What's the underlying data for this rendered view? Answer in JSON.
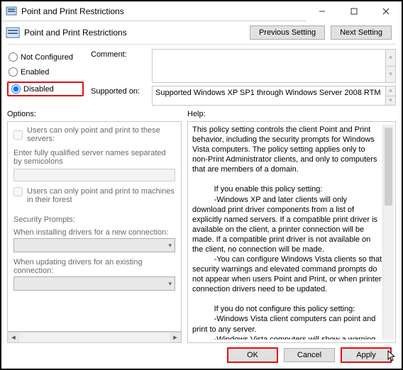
{
  "window": {
    "title": "Point and Print Restrictions"
  },
  "header": {
    "title": "Point and Print Restrictions",
    "prev": "Previous Setting",
    "next": "Next Setting"
  },
  "radios": {
    "not_configured": "Not Configured",
    "enabled": "Enabled",
    "disabled": "Disabled"
  },
  "meta": {
    "comment_label": "Comment:",
    "comment_value": "",
    "supported_label": "Supported on:",
    "supported_value": "Supported Windows XP SP1 through Windows Server 2008 RTM"
  },
  "options": {
    "header": "Options:",
    "chk1": "Users can only point and print to these servers:",
    "text1": "Enter fully qualified server names separated by semicolons",
    "chk2": "Users can only point and print to machines in their forest",
    "sec_prompts": "Security Prompts:",
    "install_label": "When installing drivers for a new connection:",
    "update_label": "When updating drivers for an existing connection:"
  },
  "help": {
    "header": "Help:",
    "text": "This policy setting controls the client Point and Print behavior, including the security prompts for Windows Vista computers. The policy setting applies only to non-Print Administrator clients, and only to computers that are members of a domain.\n\n          If you enable this policy setting:\n          -Windows XP and later clients will only download print driver components from a list of explicitly named servers. If a compatible print driver is available on the client, a printer connection will be made. If a compatible print driver is not available on the client, no connection will be made.\n          -You can configure Windows Vista clients so that security warnings and elevated command prompts do not appear when users Point and Print, or when printer connection drivers need to be updated.\n\n          If you do not configure this policy setting:\n          -Windows Vista client computers can point and print to any server.\n          -Windows Vista computers will show a warning and an elevated command prompt when users create a printer"
  },
  "footer": {
    "ok": "OK",
    "cancel": "Cancel",
    "apply": "Apply"
  }
}
